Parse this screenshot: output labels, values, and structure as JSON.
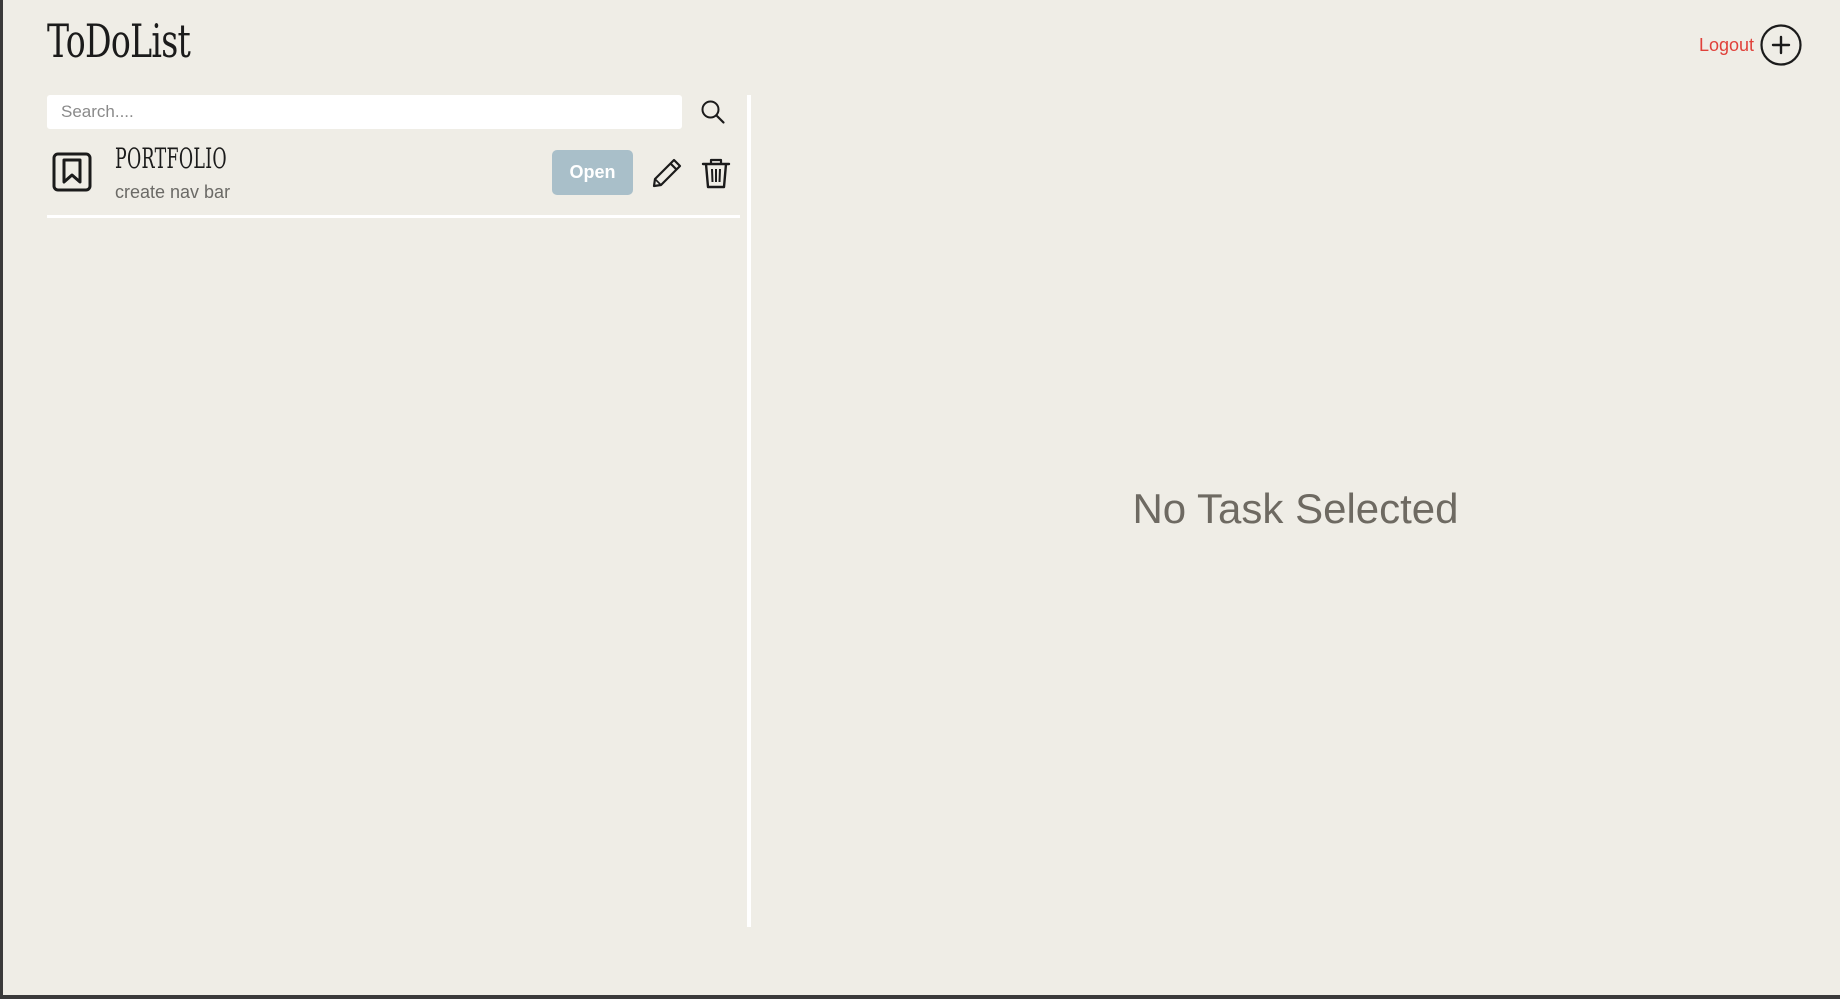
{
  "header": {
    "app_title": "ToDoList",
    "logout_label": "Logout",
    "add_icon": "plus-circle-icon"
  },
  "search": {
    "placeholder": "Search....",
    "value": "",
    "search_icon": "magnifier-icon"
  },
  "tasks": [
    {
      "icon": "bookmark-icon",
      "title": "PORTFOLIO",
      "description": "create nav bar",
      "open_label": "Open",
      "edit_icon": "pencil-icon",
      "delete_icon": "trash-icon"
    }
  ],
  "detail": {
    "empty_message": "No Task Selected"
  },
  "colors": {
    "background": "#efede6",
    "logout": "#e0413a",
    "open_button": "#a9bfc9",
    "divider": "#ffffff"
  }
}
